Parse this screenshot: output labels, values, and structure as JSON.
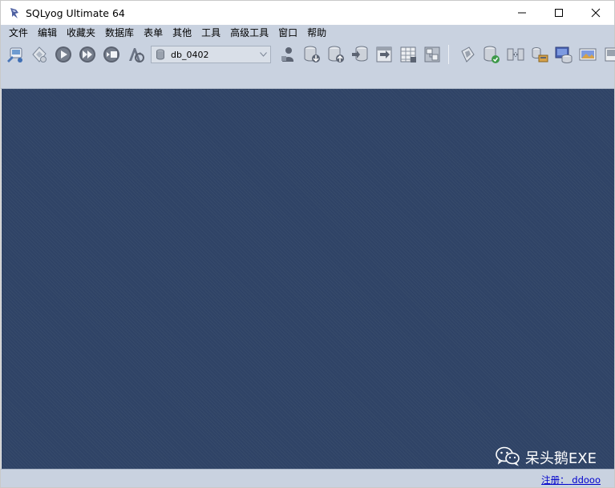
{
  "window": {
    "title": "SQLyog Ultimate 64",
    "controls": {
      "minimize": "minimize",
      "maximize": "maximize",
      "close": "close"
    }
  },
  "menu": {
    "items": [
      {
        "label": "文件",
        "name": "menu-file"
      },
      {
        "label": "编辑",
        "name": "menu-edit"
      },
      {
        "label": "收藏夹",
        "name": "menu-favorites"
      },
      {
        "label": "数据库",
        "name": "menu-database"
      },
      {
        "label": "表单",
        "name": "menu-table"
      },
      {
        "label": "其他",
        "name": "menu-others"
      },
      {
        "label": "工具",
        "name": "menu-tools"
      },
      {
        "label": "高级工具",
        "name": "menu-powertools"
      },
      {
        "label": "窗口",
        "name": "menu-window"
      },
      {
        "label": "帮助",
        "name": "menu-help"
      }
    ]
  },
  "toolbar": {
    "database_selector": {
      "value": "db_0402"
    },
    "icons_left": [
      "new-connection-icon",
      "new-query-icon",
      "execute-query-icon",
      "execute-all-icon",
      "stop-icon",
      "refresh-icon"
    ],
    "icons_right_a": [
      "user-manager-icon",
      "backup-db-icon",
      "restore-db-icon",
      "import-icon",
      "export-table-icon",
      "table-designer-icon",
      "schema-designer-icon"
    ],
    "icons_right_b": [
      "query-builder-icon",
      "schema-sync-icon",
      "data-sync-icon",
      "import-external-icon",
      "scheduled-backup-icon",
      "notification-icon",
      "more-icon"
    ]
  },
  "workspace": {
    "watermark": "呆头鹅EXE"
  },
  "status": {
    "registration_label": "注册：",
    "registration_user": "ddooo"
  },
  "colors": {
    "workspace_bg": "#2f4366",
    "toolbar_bg": "#c9d2e0",
    "link": "#0000cc"
  }
}
